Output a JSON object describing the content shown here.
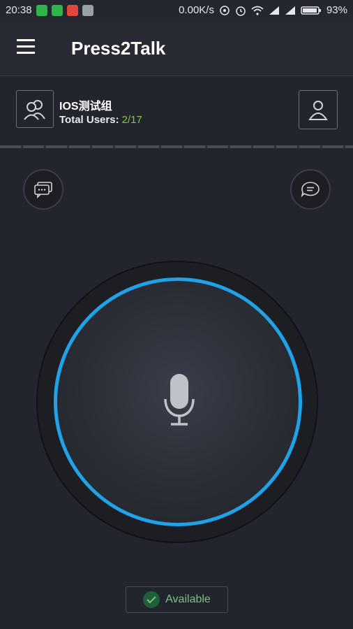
{
  "status_bar": {
    "time": "20:38",
    "net_speed": "0.00K/s",
    "battery": "93%"
  },
  "app_bar": {
    "title": "Press2Talk"
  },
  "group": {
    "name": "IOS测试组",
    "total_users_label": "Total Users:",
    "total_users_value": "2/17"
  },
  "ptt": {
    "ring_color": "#1fa3e6"
  },
  "status": {
    "label": "Available",
    "color": "#7fbf7f"
  }
}
